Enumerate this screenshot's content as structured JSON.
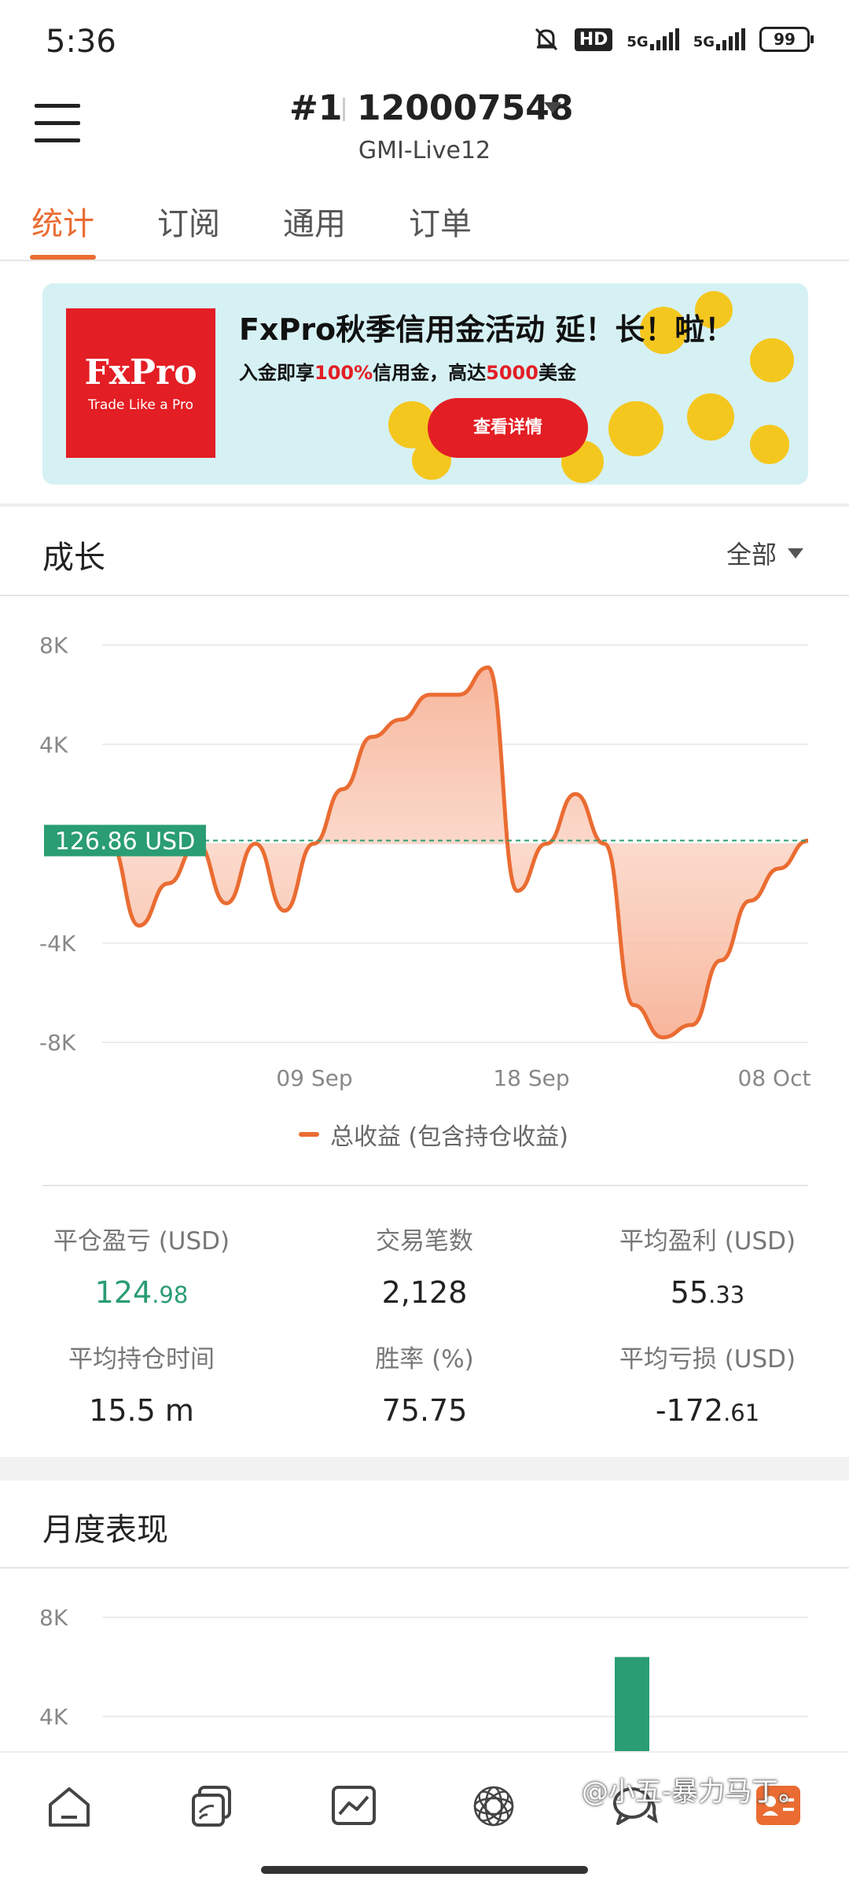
{
  "status_bar": {
    "time": "5:36",
    "hd": "HD",
    "signal1": "5G",
    "signal2": "5G",
    "battery": "99"
  },
  "header": {
    "title": "#1",
    "account": "120007548",
    "server": "GMI-Live12"
  },
  "tabs": [
    {
      "label": "统计",
      "active": true
    },
    {
      "label": "订阅",
      "active": false
    },
    {
      "label": "通用",
      "active": false
    },
    {
      "label": "订单",
      "active": false
    }
  ],
  "banner": {
    "logo_main": "FxPro",
    "logo_sub": "Trade Like a Pro",
    "title": "FxPro秋季信用金活动 延！长！啦！",
    "subtitle_a": "入金即享",
    "subtitle_pct": "100%",
    "subtitle_b": "信用金，高达",
    "subtitle_amt": "5000",
    "subtitle_c": "美金",
    "button": "查看详情"
  },
  "growth": {
    "title": "成长",
    "filter": "全部",
    "current_value_label": "126.86 USD",
    "legend": "总收益 (包含持仓收益)"
  },
  "chart_data": {
    "type": "area",
    "ylim": [
      -8000,
      8000
    ],
    "yticks": [
      "8K",
      "4K",
      "0",
      "-4K",
      "-8K"
    ],
    "xticks": [
      "09 Sep",
      "18 Sep",
      "08 Oct"
    ],
    "series": [
      {
        "values": [
          0,
          -3300,
          -1600,
          0,
          -2400,
          0,
          -2700,
          0,
          2200,
          4300,
          5000,
          6000,
          6000,
          7100,
          -1900,
          0,
          2000,
          0,
          -6500,
          -7800,
          -7300,
          -4700,
          -2300,
          -1000,
          127
        ]
      }
    ],
    "accent": "#ea6c32",
    "marker_color": "#2a9d72"
  },
  "stats": [
    {
      "label": "平仓盈亏 (USD)",
      "int": "124",
      "dec": ".98",
      "green": true
    },
    {
      "label": "交易笔数",
      "int": "2,128",
      "dec": "",
      "green": false
    },
    {
      "label": "平均盈利 (USD)",
      "int": "55",
      "dec": ".33",
      "green": false
    },
    {
      "label": "平均持仓时间",
      "int": "15.5 m",
      "dec": "",
      "green": false
    },
    {
      "label": "胜率 (%)",
      "int": "75.75",
      "dec": "",
      "green": false
    },
    {
      "label": "平均亏损 (USD)",
      "int": "-172",
      "dec": ".61",
      "green": false
    }
  ],
  "monthly": {
    "title": "月度表现",
    "yticks": [
      "8K",
      "4K"
    ],
    "bar_color": "#2a9d72",
    "bar_value": 6400
  },
  "nav": [
    "home-icon",
    "copy-icon",
    "chart-icon",
    "discover-icon",
    "chat-icon",
    "profile-icon"
  ],
  "watermark": "@小五-暴力马丁。"
}
